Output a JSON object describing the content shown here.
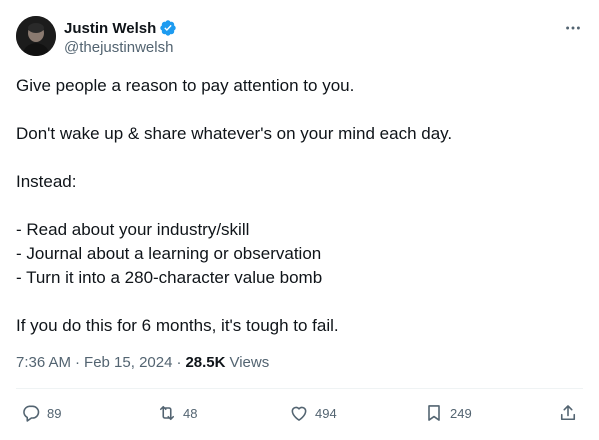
{
  "author": {
    "display_name": "Justin Welsh",
    "handle": "@thejustinwelsh",
    "verified": true
  },
  "tweet": {
    "lines": [
      "Give people a reason to pay attention to you.",
      "",
      "Don't wake up & share whatever's on your mind each day.",
      "",
      "Instead:",
      "",
      "- Read about your industry/skill",
      "- Journal about a learning or observation",
      "- Turn it into a 280-character value bomb",
      "",
      "If you do this for 6 months, it's tough to fail."
    ]
  },
  "meta": {
    "time": "7:36 AM",
    "date": "Feb 15, 2024",
    "views_count": "28.5K",
    "views_label": "Views",
    "separator": "·"
  },
  "actions": {
    "replies": "89",
    "retweets": "48",
    "likes": "494",
    "bookmarks": "249"
  },
  "icons": {
    "verified": "verified-badge-icon",
    "more": "more-icon",
    "reply": "reply-icon",
    "retweet": "retweet-icon",
    "like": "heart-icon",
    "bookmark": "bookmark-icon",
    "share": "share-icon"
  },
  "colors": {
    "text": "#0f1419",
    "secondary": "#536471",
    "verified": "#1d9bf0",
    "divider": "#eff3f4"
  }
}
